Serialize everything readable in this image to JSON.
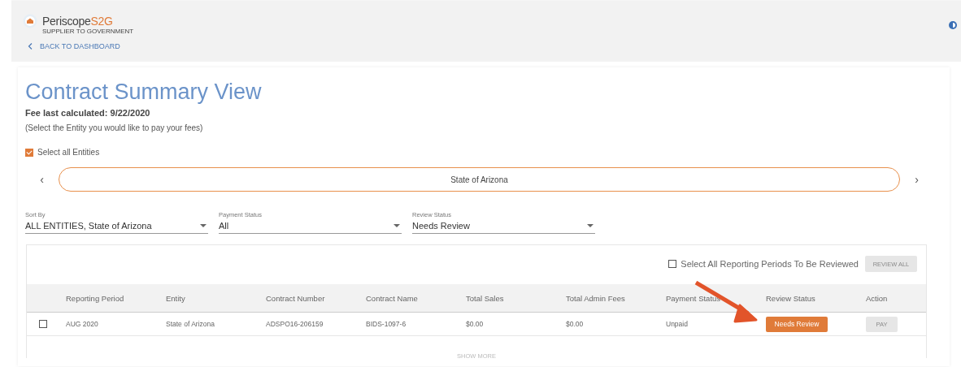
{
  "header": {
    "logo": {
      "name": "Periscope",
      "accent": "S2G",
      "tagline": "SUPPLIER TO GOVERNMENT"
    },
    "back_link": "BACK TO DASHBOARD"
  },
  "page": {
    "title": "Contract Summary View",
    "fee_note": "Fee last calculated: 9/22/2020",
    "instruction": "(Select the Entity you would like to pay your fees)"
  },
  "select_all_entities": {
    "label": "Select all Entities",
    "checked": true
  },
  "carousel": {
    "prev": "‹",
    "entity": "State of Arizona",
    "next": "›"
  },
  "filters": [
    {
      "label": "Sort By",
      "value": "ALL ENTITIES, State of Arizona"
    },
    {
      "label": "Payment Status",
      "value": "All"
    },
    {
      "label": "Review Status",
      "value": "Needs Review"
    }
  ],
  "toolbar": {
    "select_all_periods": {
      "label": "Select All Reporting Periods To Be Reviewed",
      "checked": false
    },
    "review_all": {
      "label": "REVIEW ALL",
      "disabled": true
    }
  },
  "table": {
    "columns": [
      "Reporting Period",
      "Entity",
      "Contract Number",
      "Contract Name",
      "Total Sales",
      "Total Admin Fees",
      "Payment Status",
      "Review Status",
      "Action"
    ],
    "rows": [
      {
        "checked": false,
        "cells": [
          "AUG 2020",
          "State of Arizona",
          "ADSPO16-206159",
          "BIDS-1097-6",
          "$0.00",
          "$0.00",
          "Unpaid"
        ],
        "review_status": {
          "label": "Needs Review",
          "kind": "needs-review"
        },
        "action": {
          "label": "PAY",
          "disabled": true
        }
      }
    ]
  },
  "show_more": "SHOW MORE"
}
